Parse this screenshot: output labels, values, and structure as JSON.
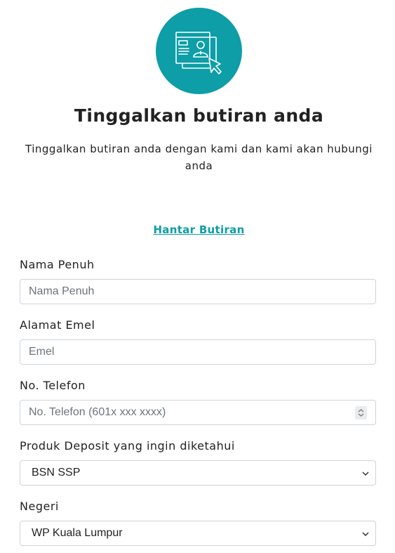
{
  "header": {
    "title": "Tinggalkan butiran anda",
    "subtitle": "Tinggalkan butiran anda dengan kami dan kami akan hubungi anda",
    "icon": "contact-form-icon",
    "accent_color": "#0d9ea7"
  },
  "submit_link": "Hantar Butiran",
  "form": {
    "full_name": {
      "label": "Nama Penuh",
      "placeholder": "Nama Penuh",
      "value": ""
    },
    "email": {
      "label": "Alamat Emel",
      "placeholder": "Emel",
      "value": ""
    },
    "phone": {
      "label": "No. Telefon",
      "placeholder": "No. Telefon (601x xxx xxxx)",
      "value": ""
    },
    "product": {
      "label": "Produk Deposit yang ingin diketahui",
      "selected": "BSN SSP"
    },
    "state": {
      "label": "Negeri",
      "selected": "WP Kuala Lumpur"
    }
  }
}
